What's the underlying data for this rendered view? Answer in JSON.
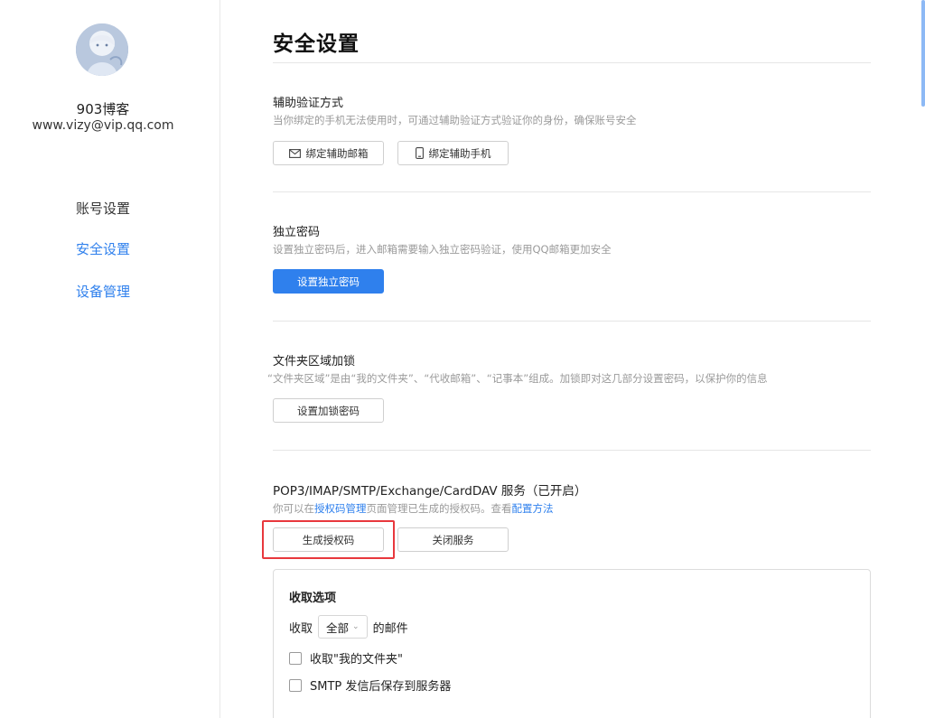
{
  "sidebar": {
    "user_name": "903博客",
    "user_email": "www.vizy@vip.qq.com",
    "nav": [
      {
        "label": "账号设置"
      },
      {
        "label": "安全设置"
      },
      {
        "label": "设备管理"
      }
    ]
  },
  "main": {
    "title": "安全设置",
    "aux_verify": {
      "title": "辅助验证方式",
      "desc": "当你绑定的手机无法使用时，可通过辅助验证方式验证你的身份，确保账号安全",
      "bind_email_label": "绑定辅助邮箱",
      "bind_phone_label": "绑定辅助手机"
    },
    "independent_pwd": {
      "title": "独立密码",
      "desc": "设置独立密码后，进入邮箱需要输入独立密码验证，使用QQ邮箱更加安全",
      "button_label": "设置独立密码"
    },
    "folder_lock": {
      "title": "文件夹区域加锁",
      "desc": "“文件夹区域”是由“我的文件夹”、“代收邮箱”、“记事本”组成。加锁即对这几部分设置密码，以保护你的信息",
      "button_label": "设置加锁密码"
    },
    "pop3": {
      "title": "POP3/IMAP/SMTP/Exchange/CardDAV 服务（已开启）",
      "desc_prefix": "你可以在",
      "desc_link1": "授权码管理",
      "desc_middle": "页面管理已生成的授权码。查看",
      "desc_link2": "配置方法",
      "gen_code_label": "生成授权码",
      "close_service_label": "关闭服务"
    },
    "receive_options": {
      "title": "收取选项",
      "prefix": "收取",
      "selected": "全部",
      "suffix": "的邮件",
      "option1": "收取\"我的文件夹\"",
      "option2": "SMTP 发信后保存到服务器"
    }
  },
  "colors": {
    "accent": "#2f80ed",
    "highlight": "#e8383d"
  }
}
